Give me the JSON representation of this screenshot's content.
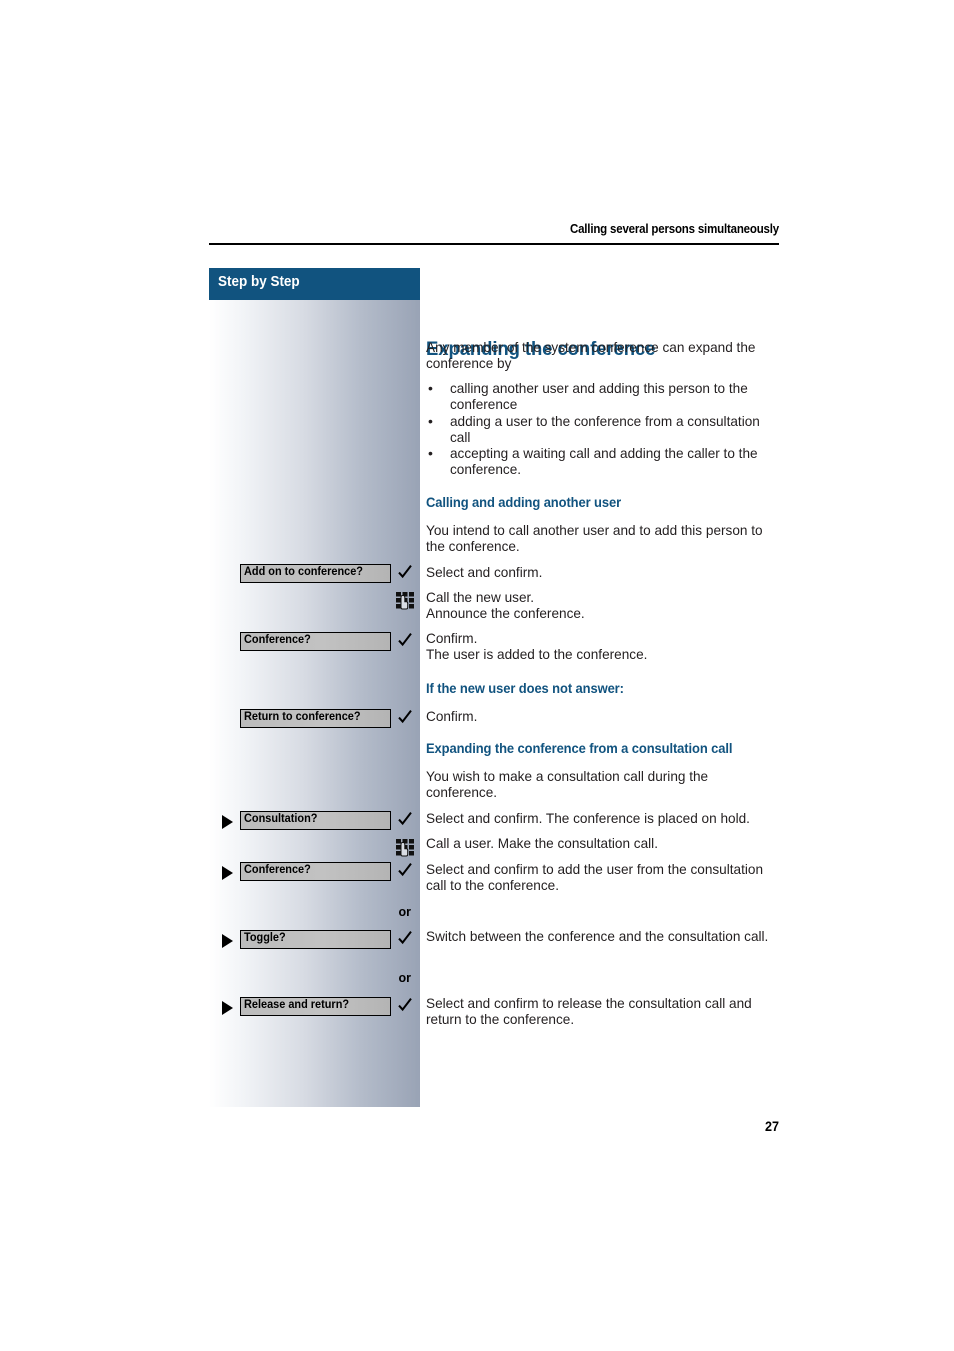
{
  "header": {
    "running_title": "Calling several persons simultaneously"
  },
  "sidebar": {
    "title": "Step by Step",
    "rows": [
      {
        "label": "Add on to conference?",
        "icon": "check-icon",
        "arrow": false
      },
      {
        "label": "",
        "icon": "keypad-icon",
        "arrow": false
      },
      {
        "label": "Conference?",
        "icon": "check-icon",
        "arrow": false
      },
      {
        "label": "Return to conference?",
        "icon": "check-icon",
        "arrow": false
      },
      {
        "label": "Consultation?",
        "icon": "check-icon",
        "arrow": true
      },
      {
        "label": "",
        "icon": "keypad-icon",
        "arrow": false
      },
      {
        "label": "Conference?",
        "icon": "check-icon",
        "arrow": true
      },
      {
        "label": "Toggle?",
        "icon": "check-icon",
        "arrow": true
      },
      {
        "label": "Release and return?",
        "icon": "check-icon",
        "arrow": true
      }
    ],
    "or_label_1": "or",
    "or_label_2": "or"
  },
  "main": {
    "title": "Expanding the conference",
    "intro": "Any member of the system conference can expand the conference by",
    "bullets": [
      "calling another user and adding this person to the conference",
      "adding a user to the conference from a consultation call",
      "accepting a waiting call and adding the caller to the conference."
    ],
    "section1": {
      "heading": "Calling and adding another user",
      "p1": "You intend to call another user and to add this person to the conference.",
      "p2": "Select and confirm.",
      "p3": "Call the new user.\nAnnounce the conference.",
      "p4": "Confirm.\nThe user is added to the conference."
    },
    "section2": {
      "heading": "If the new user does not answer:",
      "p1": "Confirm."
    },
    "section3": {
      "heading": "Expanding the conference from a consultation call",
      "p1": "You wish to make a consultation call during the conference.",
      "p2": "Select and confirm. The conference is placed on hold.",
      "p3": "Call a user. Make the consultation call.",
      "p4": "Select and confirm to add the user from the consultation call to the conference.",
      "p5": "Switch between the conference and the consultation call.",
      "p6": "Select and confirm to release the consultation call and return to the conference."
    }
  },
  "footer": {
    "page_number": "27"
  },
  "colors": {
    "brand_blue": "#11537f",
    "sidebar_gradient_start": "#ffffff",
    "sidebar_gradient_end": "#99a3b5",
    "text": "#231f20"
  }
}
